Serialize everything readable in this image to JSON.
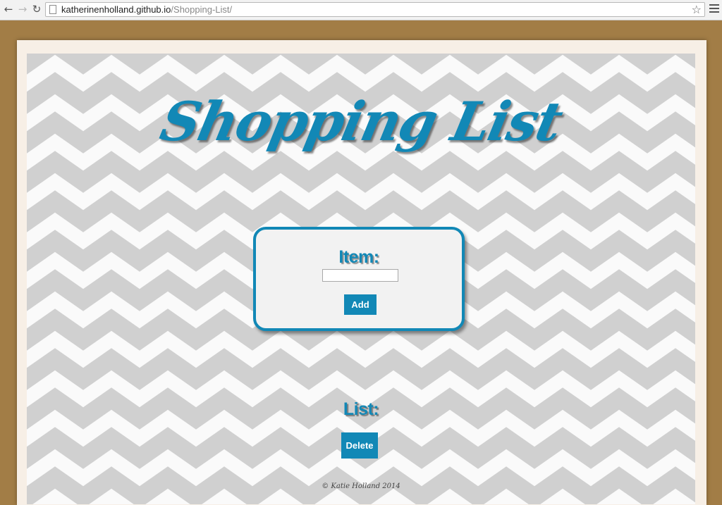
{
  "browser": {
    "url_host": "katherinenholland.github.io",
    "url_path": "/Shopping-List/",
    "icons": {
      "back": "arrow-left-icon",
      "forward": "arrow-right-icon",
      "reload": "reload-icon",
      "bookmark": "star-icon",
      "menu": "hamburger-menu-icon",
      "page": "page-icon"
    }
  },
  "page": {
    "title": "Shopping List",
    "item_label": "Item:",
    "item_input_value": "",
    "add_label": "Add",
    "list_label": "List:",
    "delete_label": "Delete",
    "footer": "© Katie Holland 2014"
  },
  "colors": {
    "accent": "#1288b6",
    "frame": "#a27d46",
    "chevron_gray": "#d0d0d0",
    "chevron_white": "#fafafa"
  }
}
